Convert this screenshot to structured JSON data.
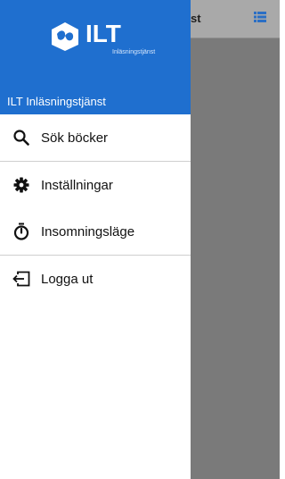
{
  "background_app": {
    "title_partial": "st",
    "list_icon": "list-icon"
  },
  "drawer": {
    "logo_text": "ILT",
    "logo_subtitle": "Inläsningstjänst",
    "header_title": "ILT Inläsningstjänst",
    "header_color": "#1f6fcf",
    "items": [
      {
        "label": "Sök böcker",
        "icon": "search-icon"
      },
      {
        "label": "Inställningar",
        "icon": "gear-icon"
      },
      {
        "label": "Insomningsläge",
        "icon": "timer-icon"
      },
      {
        "label": "Logga ut",
        "icon": "logout-icon"
      }
    ]
  }
}
